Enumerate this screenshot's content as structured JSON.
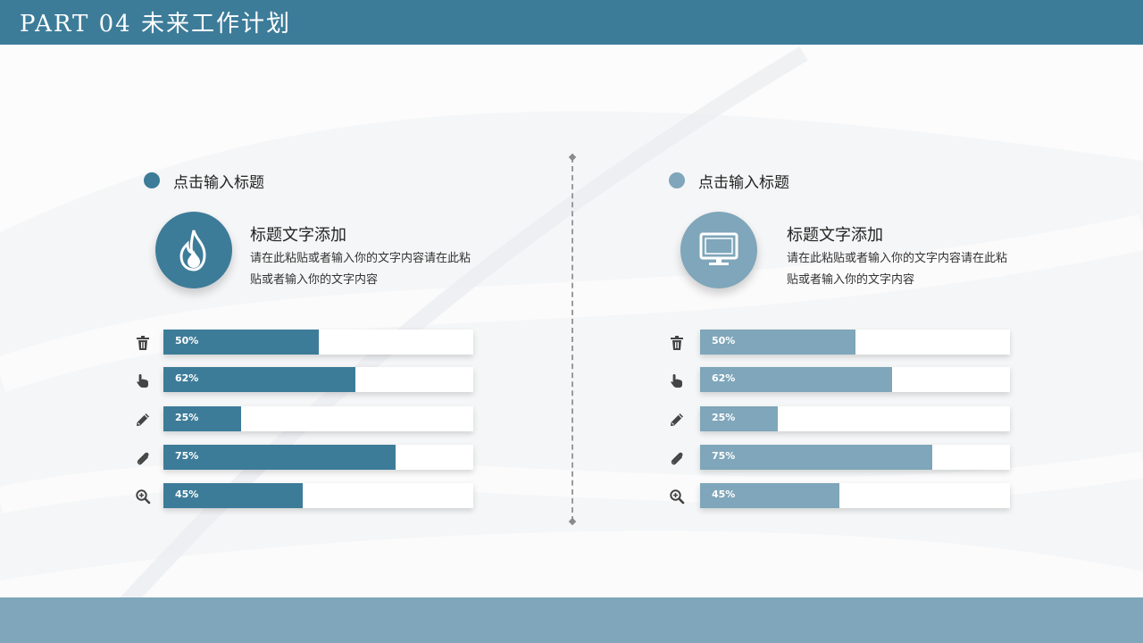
{
  "header": {
    "title": "PART 04   未来工作计划"
  },
  "colors": {
    "primary": "#3d7c99",
    "secondary": "#7fa6ba",
    "footer": "#7fa6ba"
  },
  "left": {
    "section_title": "点击输入标题",
    "badge_icon": "flame-icon",
    "item_title": "标题文字添加",
    "item_desc": "请在此粘贴或者输入你的文字内容请在此粘贴或者输入你的文字内容",
    "bars": [
      {
        "icon": "trash-icon",
        "label": "50%",
        "value": 50
      },
      {
        "icon": "pointer-hand-icon",
        "label": "62%",
        "value": 62
      },
      {
        "icon": "pencil-icon",
        "label": "25%",
        "value": 25
      },
      {
        "icon": "paperclip-icon",
        "label": "75%",
        "value": 75
      },
      {
        "icon": "zoom-in-icon",
        "label": "45%",
        "value": 45
      }
    ]
  },
  "right": {
    "section_title": "点击输入标题",
    "badge_icon": "monitor-icon",
    "item_title": "标题文字添加",
    "item_desc": "请在此粘贴或者输入你的文字内容请在此粘贴或者输入你的文字内容",
    "bars": [
      {
        "icon": "trash-icon",
        "label": "50%",
        "value": 50
      },
      {
        "icon": "pointer-hand-icon",
        "label": "62%",
        "value": 62
      },
      {
        "icon": "pencil-icon",
        "label": "25%",
        "value": 25
      },
      {
        "icon": "paperclip-icon",
        "label": "75%",
        "value": 75
      },
      {
        "icon": "zoom-in-icon",
        "label": "45%",
        "value": 45
      }
    ]
  }
}
